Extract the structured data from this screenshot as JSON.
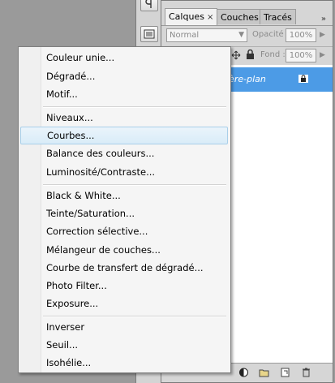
{
  "layers_panel": {
    "tabs": [
      {
        "label": "Calques",
        "close": "×",
        "active": true
      },
      {
        "label": "Couches",
        "active": false
      },
      {
        "label": "Tracés",
        "active": false
      }
    ],
    "panel_menu_icon": "»",
    "blend_mode": "Normal",
    "opacity_label": "Opacité :",
    "opacity_value": "100%",
    "fill_label": "Fond :",
    "fill_value": "100%",
    "layer_name": "ière-plan",
    "colors": {
      "selection": "#4c9be6",
      "panel_bg": "#d6d6d6"
    }
  },
  "adjustment_menu": {
    "groups": [
      [
        "Couleur unie...",
        "Dégradé...",
        "Motif..."
      ],
      [
        "Niveaux...",
        "Courbes...",
        "Balance des couleurs...",
        "Luminosité/Contraste..."
      ],
      [
        "Black & White...",
        "Teinte/Saturation...",
        "Correction sélective...",
        "Mélangeur de couches...",
        "Courbe de transfert de dégradé...",
        "Photo Filter...",
        "Exposure..."
      ],
      [
        "Inverser",
        "Seuil...",
        "Isohélie..."
      ]
    ],
    "highlighted": "Courbes..."
  }
}
